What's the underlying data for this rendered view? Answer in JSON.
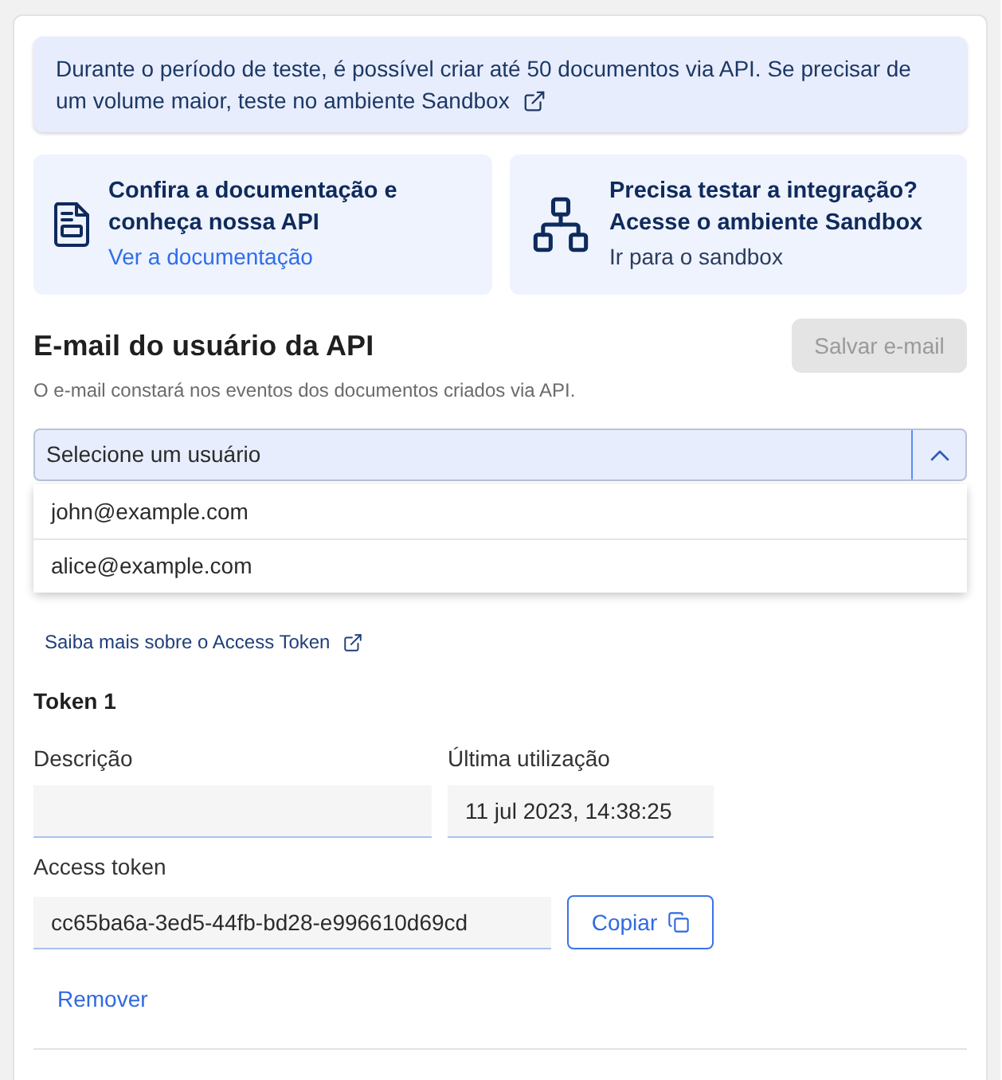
{
  "info_banner": {
    "lines": [
      "Durante o período de teste, é possível criar até 50 documentos via API. Se precisar de",
      "um volume maior, teste no ambiente Sandbox"
    ]
  },
  "feature_cards": [
    {
      "kind": "docs",
      "title_lines": [
        "Confira a documentação e",
        "conheça nossa API"
      ],
      "link": "Ver a documentação"
    },
    {
      "kind": "sandbox",
      "title_lines": [
        "Precisa testar a integração?",
        "Acesse o ambiente Sandbox"
      ],
      "link": "Ir para o sandbox"
    }
  ],
  "api_email": {
    "title": "E-mail do usuário da API",
    "save_button": {
      "label": "Salvar e-mail",
      "disabled": true
    },
    "hint": "O e-mail constará nos eventos dos documentos criados via API.",
    "select": {
      "placeholder": "Selecione um usuário",
      "expanded": true,
      "options": [
        {
          "label": "john@example.com",
          "selected": false
        },
        {
          "label": "alice@example.com",
          "selected": false
        }
      ]
    }
  },
  "access_token": {
    "link": "Saiba mais sobre o Access Token",
    "tokens": [
      {
        "title": "Token 1",
        "description": {
          "label": "Descrição"
        },
        "last_used": {
          "label": "Última utilização",
          "value": "11 jul 2023, 14:38:25"
        },
        "token": {
          "label": "Access token",
          "value": "cc65ba6a-3ed5-44fb-bd28-e996610d69cd"
        },
        "copy_button": "Copiar",
        "remove_button": "Remover"
      }
    ]
  }
}
